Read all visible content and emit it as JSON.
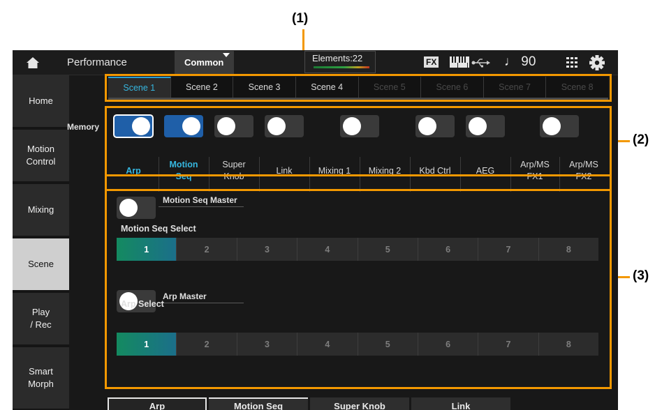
{
  "callouts": [
    "(1)",
    "(2)",
    "(3)"
  ],
  "topbar": {
    "title": "Performance",
    "common_dropdown": "Common",
    "elements": "Elements:22",
    "fx": "FX",
    "tempo": "♩ 90",
    "icons": [
      "home-icon",
      "keyboard-icon",
      "usb-icon",
      "grid-icon",
      "gear-icon"
    ]
  },
  "sidebar": {
    "items": [
      {
        "label": "Home",
        "active": false
      },
      {
        "label": "Motion\nControl",
        "active": false
      },
      {
        "label": "Mixing",
        "active": false
      },
      {
        "label": "Scene",
        "active": true
      },
      {
        "label": "Play\n/ Rec",
        "active": false
      },
      {
        "label": "Smart\nMorph",
        "active": false
      }
    ]
  },
  "scene_tabs": [
    {
      "label": "Scene 1",
      "state": "active"
    },
    {
      "label": "Scene 2",
      "state": "normal"
    },
    {
      "label": "Scene 3",
      "state": "normal"
    },
    {
      "label": "Scene 4",
      "state": "normal"
    },
    {
      "label": "Scene 5",
      "state": "dim"
    },
    {
      "label": "Scene 6",
      "state": "dim"
    },
    {
      "label": "Scene 7",
      "state": "dim"
    },
    {
      "label": "Scene 8",
      "state": "dim"
    }
  ],
  "memory": {
    "label": "Memory",
    "items": [
      {
        "label": "Arp",
        "on": true
      },
      {
        "label": "Motion\nSeq",
        "on": true
      },
      {
        "label": "Super\nKnob",
        "on": false
      },
      {
        "label": "Link",
        "on": false
      },
      {
        "label": "Mixing 1",
        "on": false
      },
      {
        "label": "Mixing 2",
        "on": false
      },
      {
        "label": "Kbd Ctrl",
        "on": false
      },
      {
        "label": "AEG",
        "on": false
      },
      {
        "label": "Arp/MS\nFX1",
        "on": false
      },
      {
        "label": "Arp/MS\nFX2",
        "on": false
      }
    ]
  },
  "motion_seq": {
    "master_label": "Motion Seq Master",
    "master_on": false,
    "select_label": "Motion Seq Select",
    "options": [
      "1",
      "2",
      "3",
      "4",
      "5",
      "6",
      "7",
      "8"
    ],
    "selected": "1"
  },
  "arp": {
    "master_label": "Arp Master",
    "master_on": false,
    "select_label": "Arp Select",
    "options": [
      "1",
      "2",
      "3",
      "4",
      "5",
      "6",
      "7",
      "8"
    ],
    "selected": "1"
  },
  "bottom_tabs": [
    "Arp",
    "Motion Seq",
    "Super Knob",
    "Link"
  ],
  "colors": {
    "accent_blue": "#36b7e0",
    "toggle_on": "#1f5fa8",
    "select_active_start": "#148a60",
    "select_active_end": "#1b6f8a",
    "annotation": "#f39800"
  }
}
